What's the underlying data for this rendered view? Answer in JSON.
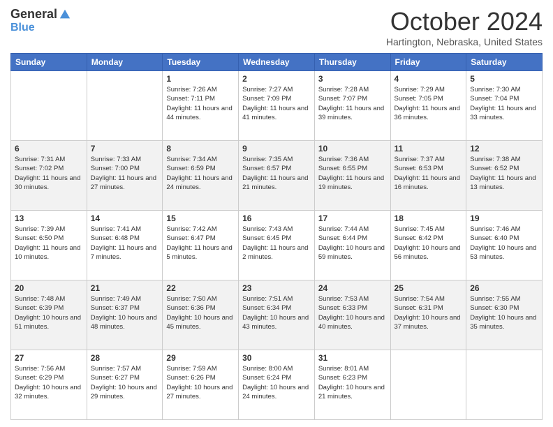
{
  "logo": {
    "general": "General",
    "blue": "Blue"
  },
  "header": {
    "month": "October 2024",
    "location": "Hartington, Nebraska, United States"
  },
  "days_of_week": [
    "Sunday",
    "Monday",
    "Tuesday",
    "Wednesday",
    "Thursday",
    "Friday",
    "Saturday"
  ],
  "weeks": [
    [
      {
        "day": "",
        "info": ""
      },
      {
        "day": "",
        "info": ""
      },
      {
        "day": "1",
        "info": "Sunrise: 7:26 AM\nSunset: 7:11 PM\nDaylight: 11 hours and 44 minutes."
      },
      {
        "day": "2",
        "info": "Sunrise: 7:27 AM\nSunset: 7:09 PM\nDaylight: 11 hours and 41 minutes."
      },
      {
        "day": "3",
        "info": "Sunrise: 7:28 AM\nSunset: 7:07 PM\nDaylight: 11 hours and 39 minutes."
      },
      {
        "day": "4",
        "info": "Sunrise: 7:29 AM\nSunset: 7:05 PM\nDaylight: 11 hours and 36 minutes."
      },
      {
        "day": "5",
        "info": "Sunrise: 7:30 AM\nSunset: 7:04 PM\nDaylight: 11 hours and 33 minutes."
      }
    ],
    [
      {
        "day": "6",
        "info": "Sunrise: 7:31 AM\nSunset: 7:02 PM\nDaylight: 11 hours and 30 minutes."
      },
      {
        "day": "7",
        "info": "Sunrise: 7:33 AM\nSunset: 7:00 PM\nDaylight: 11 hours and 27 minutes."
      },
      {
        "day": "8",
        "info": "Sunrise: 7:34 AM\nSunset: 6:59 PM\nDaylight: 11 hours and 24 minutes."
      },
      {
        "day": "9",
        "info": "Sunrise: 7:35 AM\nSunset: 6:57 PM\nDaylight: 11 hours and 21 minutes."
      },
      {
        "day": "10",
        "info": "Sunrise: 7:36 AM\nSunset: 6:55 PM\nDaylight: 11 hours and 19 minutes."
      },
      {
        "day": "11",
        "info": "Sunrise: 7:37 AM\nSunset: 6:53 PM\nDaylight: 11 hours and 16 minutes."
      },
      {
        "day": "12",
        "info": "Sunrise: 7:38 AM\nSunset: 6:52 PM\nDaylight: 11 hours and 13 minutes."
      }
    ],
    [
      {
        "day": "13",
        "info": "Sunrise: 7:39 AM\nSunset: 6:50 PM\nDaylight: 11 hours and 10 minutes."
      },
      {
        "day": "14",
        "info": "Sunrise: 7:41 AM\nSunset: 6:48 PM\nDaylight: 11 hours and 7 minutes."
      },
      {
        "day": "15",
        "info": "Sunrise: 7:42 AM\nSunset: 6:47 PM\nDaylight: 11 hours and 5 minutes."
      },
      {
        "day": "16",
        "info": "Sunrise: 7:43 AM\nSunset: 6:45 PM\nDaylight: 11 hours and 2 minutes."
      },
      {
        "day": "17",
        "info": "Sunrise: 7:44 AM\nSunset: 6:44 PM\nDaylight: 10 hours and 59 minutes."
      },
      {
        "day": "18",
        "info": "Sunrise: 7:45 AM\nSunset: 6:42 PM\nDaylight: 10 hours and 56 minutes."
      },
      {
        "day": "19",
        "info": "Sunrise: 7:46 AM\nSunset: 6:40 PM\nDaylight: 10 hours and 53 minutes."
      }
    ],
    [
      {
        "day": "20",
        "info": "Sunrise: 7:48 AM\nSunset: 6:39 PM\nDaylight: 10 hours and 51 minutes."
      },
      {
        "day": "21",
        "info": "Sunrise: 7:49 AM\nSunset: 6:37 PM\nDaylight: 10 hours and 48 minutes."
      },
      {
        "day": "22",
        "info": "Sunrise: 7:50 AM\nSunset: 6:36 PM\nDaylight: 10 hours and 45 minutes."
      },
      {
        "day": "23",
        "info": "Sunrise: 7:51 AM\nSunset: 6:34 PM\nDaylight: 10 hours and 43 minutes."
      },
      {
        "day": "24",
        "info": "Sunrise: 7:53 AM\nSunset: 6:33 PM\nDaylight: 10 hours and 40 minutes."
      },
      {
        "day": "25",
        "info": "Sunrise: 7:54 AM\nSunset: 6:31 PM\nDaylight: 10 hours and 37 minutes."
      },
      {
        "day": "26",
        "info": "Sunrise: 7:55 AM\nSunset: 6:30 PM\nDaylight: 10 hours and 35 minutes."
      }
    ],
    [
      {
        "day": "27",
        "info": "Sunrise: 7:56 AM\nSunset: 6:29 PM\nDaylight: 10 hours and 32 minutes."
      },
      {
        "day": "28",
        "info": "Sunrise: 7:57 AM\nSunset: 6:27 PM\nDaylight: 10 hours and 29 minutes."
      },
      {
        "day": "29",
        "info": "Sunrise: 7:59 AM\nSunset: 6:26 PM\nDaylight: 10 hours and 27 minutes."
      },
      {
        "day": "30",
        "info": "Sunrise: 8:00 AM\nSunset: 6:24 PM\nDaylight: 10 hours and 24 minutes."
      },
      {
        "day": "31",
        "info": "Sunrise: 8:01 AM\nSunset: 6:23 PM\nDaylight: 10 hours and 21 minutes."
      },
      {
        "day": "",
        "info": ""
      },
      {
        "day": "",
        "info": ""
      }
    ]
  ]
}
